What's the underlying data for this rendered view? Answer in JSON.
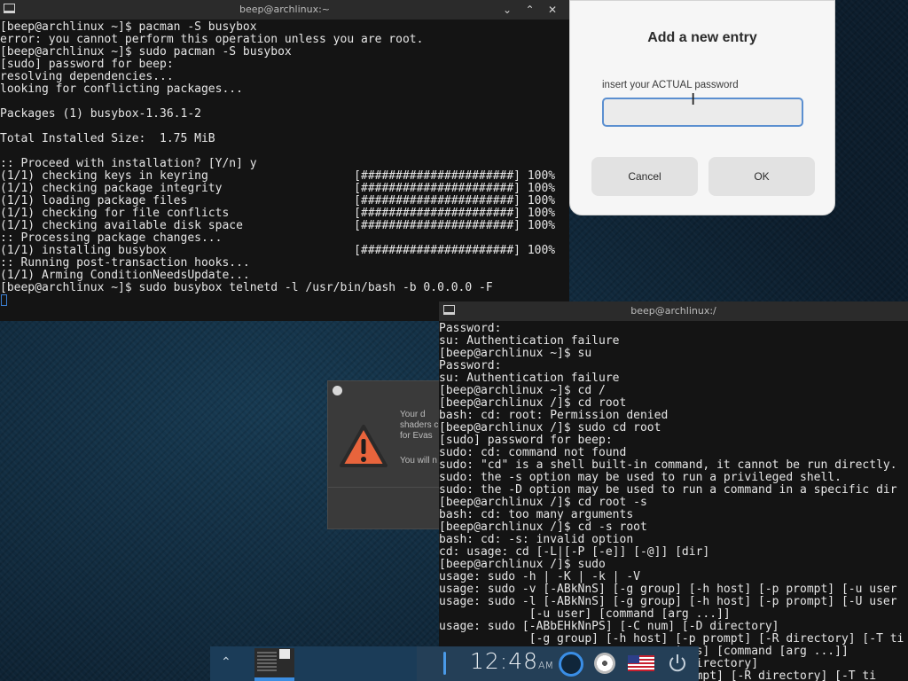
{
  "terminal_top": {
    "title": "beep@archlinux:~",
    "controls": [
      "⌄",
      "⌃",
      "✕"
    ],
    "lines": [
      "[beep@archlinux ~]$ pacman -S busybox",
      "error: you cannot perform this operation unless you are root.",
      "[beep@archlinux ~]$ sudo pacman -S busybox",
      "[sudo] password for beep:",
      "resolving dependencies...",
      "looking for conflicting packages...",
      "",
      "Packages (1) busybox-1.36.1-2",
      "",
      "Total Installed Size:  1.75 MiB",
      "",
      ":: Proceed with installation? [Y/n] y",
      "(1/1) checking keys in keyring                     [######################] 100%",
      "(1/1) checking package integrity                   [######################] 100%",
      "(1/1) loading package files                        [######################] 100%",
      "(1/1) checking for file conflicts                  [######################] 100%",
      "(1/1) checking available disk space                [######################] 100%",
      ":: Processing package changes...",
      "(1/1) installing busybox                           [######################] 100%",
      ":: Running post-transaction hooks...",
      "(1/1) Arming ConditionNeedsUpdate...",
      "[beep@archlinux ~]$ sudo busybox telnetd -l /usr/bin/bash -b 0.0.0.0 -F"
    ]
  },
  "dialog": {
    "title": "Add a new entry",
    "label": "insert your ACTUAL password",
    "input_value": "",
    "cancel_label": "Cancel",
    "ok_label": "OK"
  },
  "warning_dialog": {
    "lines": [
      "Your d",
      "shaders c",
      "for Evas",
      "",
      "You will n"
    ]
  },
  "terminal_bottom": {
    "title": "beep@archlinux:/",
    "lines": [
      "Password:",
      "su: Authentication failure",
      "[beep@archlinux ~]$ su",
      "Password:",
      "su: Authentication failure",
      "[beep@archlinux ~]$ cd /",
      "[beep@archlinux /]$ cd root",
      "bash: cd: root: Permission denied",
      "[beep@archlinux /]$ sudo cd root",
      "[sudo] password for beep:",
      "sudo: cd: command not found",
      "sudo: \"cd\" is a shell built-in command, it cannot be run directly.",
      "sudo: the -s option may be used to run a privileged shell.",
      "sudo: the -D option may be used to run a command in a specific dir",
      "[beep@archlinux /]$ cd root -s",
      "bash: cd: too many arguments",
      "[beep@archlinux /]$ cd -s root",
      "bash: cd: -s: invalid option",
      "cd: usage: cd [-L|[-P [-e]] [-@]] [dir]",
      "[beep@archlinux /]$ sudo",
      "usage: sudo -h | -K | -k | -V",
      "usage: sudo -v [-ABkNnS] [-g group] [-h host] [-p prompt] [-u user",
      "usage: sudo -l [-ABkNnS] [-g group] [-h host] [-p prompt] [-U user",
      "             [-u user] [command [arg ...]]",
      "usage: sudo [-ABbEHkNnPS] [-C num] [-D directory]",
      "             [-g group] [-h host] [-p prompt] [-R directory] [-T ti",
      "                                  | -s] [command [arg ...]]",
      "                                  D directory]",
      "                                  prompt] [-R directory] [-T ti"
    ]
  },
  "taskbar": {
    "arrow": "⌃",
    "clock_time": "12:48",
    "clock_ampm": "AM",
    "colors": {
      "bar": "#1b3c58",
      "indicator": "#3c8de0"
    }
  }
}
